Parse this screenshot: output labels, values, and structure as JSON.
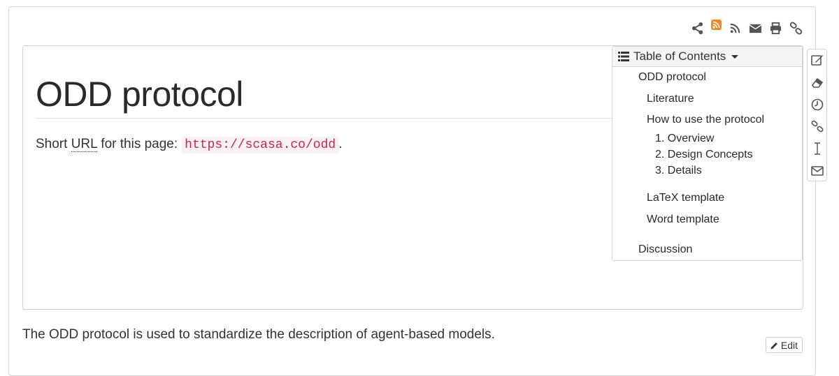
{
  "page_actions": [
    {
      "name": "share-icon"
    },
    {
      "name": "rss-badge-icon",
      "color": "#f08a24"
    },
    {
      "name": "rss-icon"
    },
    {
      "name": "email-icon"
    },
    {
      "name": "print-icon"
    },
    {
      "name": "link-icon"
    }
  ],
  "page": {
    "title": "ODD protocol",
    "short_url_prefix": "Short ",
    "short_url_abbr": "URL",
    "short_url_mid": " for this page:",
    "short_url_code": "https://scasa.co/odd",
    "short_url_suffix": ".",
    "intro": "The ODD protocol is used to standardize the description of agent-based models."
  },
  "toc": {
    "header": "Table of Contents",
    "items": [
      {
        "label": "ODD protocol"
      },
      {
        "label": "Literature"
      },
      {
        "label": "How to use the protocol"
      },
      {
        "label": "1. Overview"
      },
      {
        "label": "2. Design Concepts"
      },
      {
        "label": "3. Details"
      },
      {
        "label": "LaTeX template"
      },
      {
        "label": "Word template"
      },
      {
        "label": "Discussion"
      }
    ]
  },
  "side_tools": [
    {
      "name": "edit-icon"
    },
    {
      "name": "eraser-icon"
    },
    {
      "name": "history-icon"
    },
    {
      "name": "link-icon"
    },
    {
      "name": "text-cursor-icon"
    },
    {
      "name": "envelope-icon"
    }
  ],
  "edit_button": {
    "label": "Edit"
  },
  "colors": {
    "code_text": "#c7254e",
    "code_bg": "#f9f2f4",
    "border": "#d4d4d4"
  }
}
